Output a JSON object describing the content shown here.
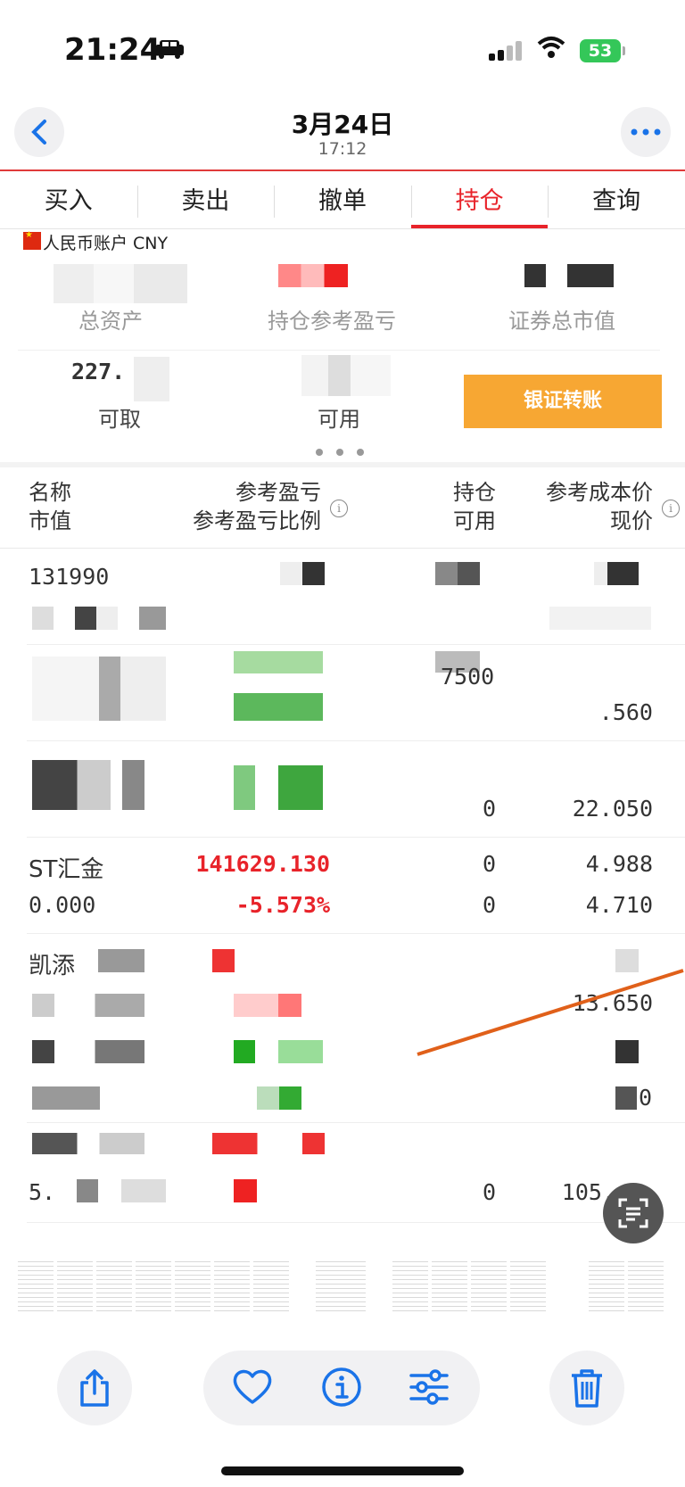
{
  "status_bar": {
    "time": "21:24",
    "battery": "53"
  },
  "header": {
    "title": "3月24日",
    "subtitle": "17:12"
  },
  "tabs": [
    {
      "label": "买入"
    },
    {
      "label": "卖出"
    },
    {
      "label": "撤单"
    },
    {
      "label": "持仓",
      "active": true
    },
    {
      "label": "查询"
    }
  ],
  "account": {
    "label": "人民币账户 CNY",
    "total_assets_label": "总资产",
    "position_pl_label": "持仓参考盈亏",
    "securities_value_label": "证券总市值",
    "available_label": "可用",
    "withdrawable_label": "可取",
    "withdrawable_value_partial": "227.",
    "transfer_button": "银证转账"
  },
  "list_header": {
    "col1_top": "名称",
    "col1_bottom": "市值",
    "col2_top": "参考盈亏",
    "col2_bottom": "参考盈亏比例",
    "col3_top": "持仓",
    "col3_bottom": "可用",
    "col4_top": "参考成本价",
    "col4_bottom": "现价"
  },
  "rows": [
    {
      "name": "131990",
      "cost": "",
      "price": "",
      "hold": "",
      "avail": ""
    },
    {
      "hold": "7500",
      "price": ".560"
    },
    {
      "hold": "0",
      "price": "22.050"
    },
    {
      "name": "ST汇金",
      "market_value": "0.000",
      "pl": "141629.130",
      "pl_ratio": "-5.573%",
      "hold": "0",
      "avail": "0",
      "cost": "4.988",
      "price": "4.710"
    },
    {
      "name": "凯添",
      "price": "13.650"
    },
    {
      "price": "0"
    },
    {
      "name": "5.",
      "hold": "0",
      "price": "105."
    }
  ],
  "colors": {
    "accent": "#e8232a",
    "transfer": "#f7a733",
    "gain": "#4caf50"
  },
  "toolbar_icons": [
    "share-icon",
    "heart-icon",
    "info-icon",
    "adjust-icon",
    "trash-icon"
  ]
}
